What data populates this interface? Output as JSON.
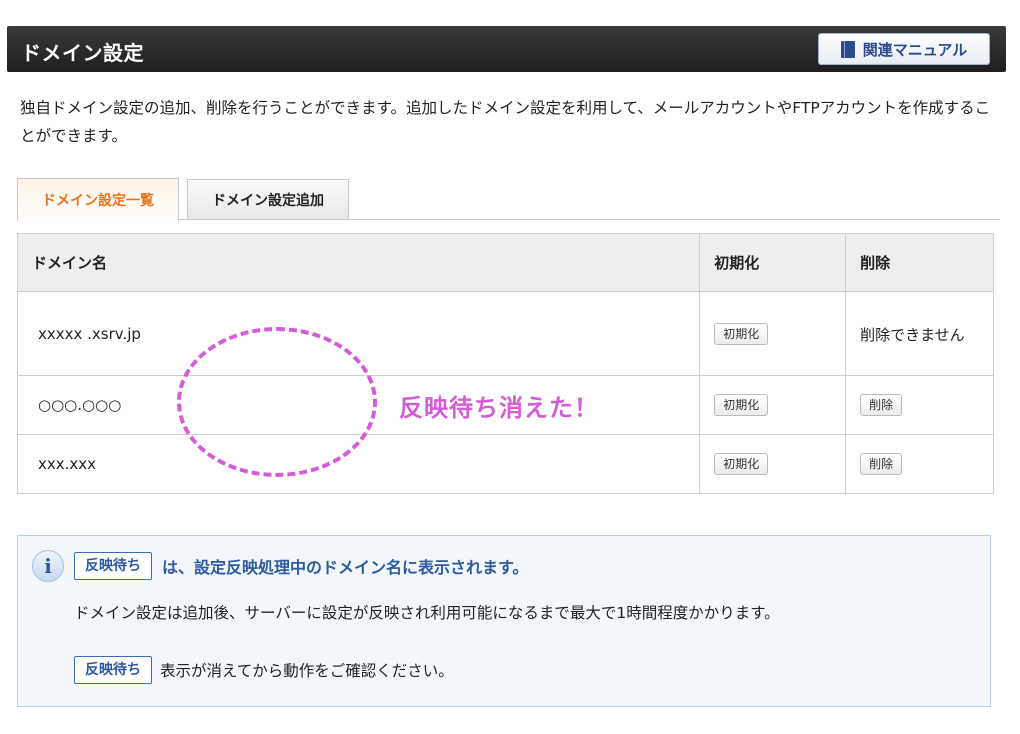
{
  "header": {
    "title": "ドメイン設定",
    "manual_button": "関連マニュアル"
  },
  "description": "独自ドメイン設定の追加、削除を行うことができます。追加したドメイン設定を利用して、メールアカウントやFTPアカウントを作成することができます。",
  "tabs": [
    {
      "label": "ドメイン設定一覧",
      "active": true
    },
    {
      "label": "ドメイン設定追加",
      "active": false
    }
  ],
  "table": {
    "headers": [
      "ドメイン名",
      "初期化",
      "削除"
    ],
    "rows": [
      {
        "domain": "xxxxx  .xsrv.jp",
        "init_label": "初期化",
        "delete_text": "削除できません"
      },
      {
        "domain": "○○○.○○○",
        "init_label": "初期化",
        "delete_label": "削除"
      },
      {
        "domain": "xxx.xxx",
        "init_label": "初期化",
        "delete_label": "削除"
      }
    ]
  },
  "annotation": {
    "text": "反映待ち消えた！",
    "color": "#d45cd6"
  },
  "info": {
    "icon": "info-icon",
    "badge": "反映待ち",
    "heading": "は、設定反映処理中のドメイン名に表示されます。",
    "body": "ドメイン設定は追加後、サーバーに設定が反映され利用可能になるまで最大で1時間程度かかります。",
    "line3_badge": "反映待ち",
    "line3_text": "表示が消えてから動作をご確認ください。"
  }
}
